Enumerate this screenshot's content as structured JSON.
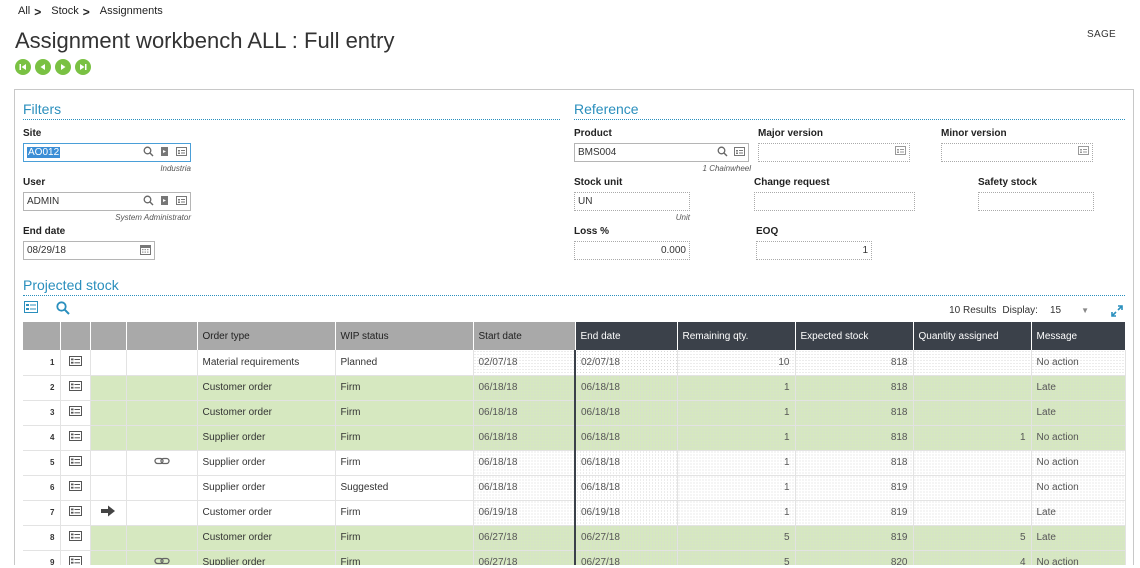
{
  "breadcrumb": {
    "all": "All",
    "stock": "Stock",
    "assignments": "Assignments",
    "sep": ">"
  },
  "page_title": "Assignment workbench ALL : Full entry",
  "brand": "SAGE",
  "filters": {
    "title": "Filters",
    "site": {
      "label": "Site",
      "value": "AO012",
      "sub": "Industria"
    },
    "user": {
      "label": "User",
      "value": "ADMIN",
      "sub": "System Administrator"
    },
    "end_date": {
      "label": "End date",
      "value": "08/29/18"
    }
  },
  "reference": {
    "title": "Reference",
    "product": {
      "label": "Product",
      "value": "BMS004",
      "sub": "1 Chainwheel"
    },
    "major_version": {
      "label": "Major version",
      "value": ""
    },
    "minor_version": {
      "label": "Minor version",
      "value": ""
    },
    "stock_unit": {
      "label": "Stock unit",
      "value": "UN",
      "sub": "Unit"
    },
    "change_request": {
      "label": "Change request",
      "value": ""
    },
    "safety_stock": {
      "label": "Safety stock",
      "value": ""
    },
    "loss": {
      "label": "Loss %",
      "value": "0.000"
    },
    "eoq": {
      "label": "EOQ",
      "value": "1"
    }
  },
  "projected": {
    "title": "Projected stock",
    "results": "10 Results",
    "display_label": "Display:",
    "display_value": "15",
    "columns": [
      "Order type",
      "WIP status",
      "Start date",
      "End date",
      "Remaining qty.",
      "Expected stock",
      "Quantity assigned",
      "Message"
    ],
    "rows": [
      {
        "n": "1",
        "link": false,
        "arrow": false,
        "green": false,
        "type": "Material requirements",
        "wip": "Planned",
        "start": "02/07/18",
        "end": "02/07/18",
        "rem": "10",
        "exp": "818",
        "qa": "",
        "msg": "No action"
      },
      {
        "n": "2",
        "link": false,
        "arrow": false,
        "green": true,
        "type": "Customer order",
        "wip": "Firm",
        "start": "06/18/18",
        "end": "06/18/18",
        "rem": "1",
        "exp": "818",
        "qa": "",
        "msg": "Late"
      },
      {
        "n": "3",
        "link": false,
        "arrow": false,
        "green": true,
        "type": "Customer order",
        "wip": "Firm",
        "start": "06/18/18",
        "end": "06/18/18",
        "rem": "1",
        "exp": "818",
        "qa": "",
        "msg": "Late"
      },
      {
        "n": "4",
        "link": false,
        "arrow": false,
        "green": true,
        "type": "Supplier order",
        "wip": "Firm",
        "start": "06/18/18",
        "end": "06/18/18",
        "rem": "1",
        "exp": "818",
        "qa": "1",
        "msg": "No action"
      },
      {
        "n": "5",
        "link": true,
        "arrow": false,
        "green": false,
        "type": "Supplier order",
        "wip": "Firm",
        "start": "06/18/18",
        "end": "06/18/18",
        "rem": "1",
        "exp": "818",
        "qa": "",
        "msg": "No action"
      },
      {
        "n": "6",
        "link": false,
        "arrow": false,
        "green": false,
        "type": "Supplier order",
        "wip": "Suggested",
        "start": "06/18/18",
        "end": "06/18/18",
        "rem": "1",
        "exp": "819",
        "qa": "",
        "msg": "No action"
      },
      {
        "n": "7",
        "link": false,
        "arrow": true,
        "green": false,
        "type": "Customer order",
        "wip": "Firm",
        "start": "06/19/18",
        "end": "06/19/18",
        "rem": "1",
        "exp": "819",
        "qa": "",
        "msg": "Late"
      },
      {
        "n": "8",
        "link": false,
        "arrow": false,
        "green": true,
        "type": "Customer order",
        "wip": "Firm",
        "start": "06/27/18",
        "end": "06/27/18",
        "rem": "5",
        "exp": "819",
        "qa": "5",
        "msg": "Late"
      },
      {
        "n": "9",
        "link": true,
        "arrow": false,
        "green": true,
        "type": "Supplier order",
        "wip": "Firm",
        "start": "06/27/18",
        "end": "06/27/18",
        "rem": "5",
        "exp": "820",
        "qa": "4",
        "msg": "No action"
      }
    ]
  },
  "colors": {
    "accent": "#2a8fbd",
    "green_nav": "#7ac143",
    "row_green": "#d6e8c0",
    "header_dark": "#3b414a",
    "header_light": "#a9a9a9"
  }
}
